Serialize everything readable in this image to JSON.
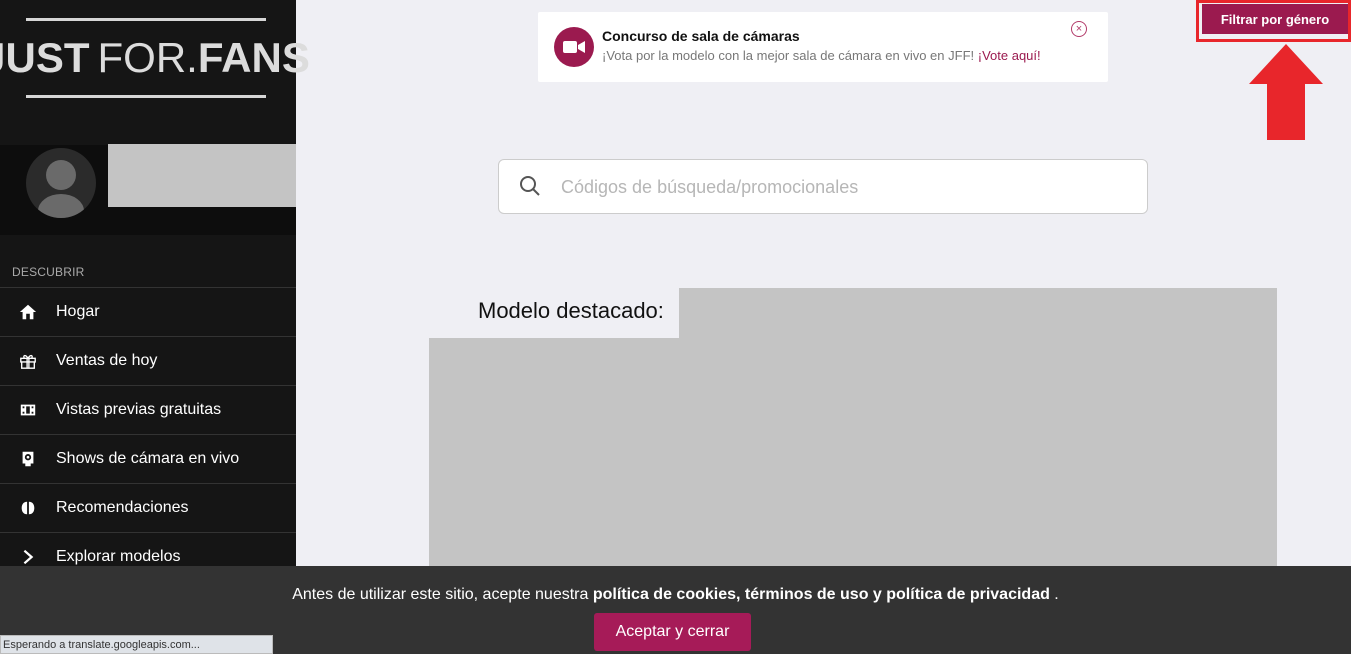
{
  "logo": {
    "part1": "JUST",
    "part2": "FOR.",
    "part3": "FANS"
  },
  "sidebar": {
    "section_label": "DESCUBRIR",
    "items": [
      {
        "label": "Hogar",
        "icon": "home-icon"
      },
      {
        "label": "Ventas de hoy",
        "icon": "gift-icon"
      },
      {
        "label": "Vistas previas gratuitas",
        "icon": "film-icon"
      },
      {
        "label": "Shows de cámara en vivo",
        "icon": "webcam-icon"
      },
      {
        "label": "Recomendaciones",
        "icon": "brain-icon"
      },
      {
        "label": "Explorar modelos",
        "icon": "chevron-right-icon"
      }
    ]
  },
  "notice": {
    "title": "Concurso de sala de cámaras",
    "text": "¡Vota por la modelo con la mejor sala de cámara en vivo en JFF! ",
    "link": "¡Vote aquí!"
  },
  "filter": {
    "label": "Filtrar por género"
  },
  "search": {
    "placeholder": "Códigos de búsqueda/promocionales"
  },
  "featured": {
    "label": "Modelo destacado:"
  },
  "cookie": {
    "prefix": "Antes de utilizar este sitio, acepte nuestra ",
    "bold": "política de cookies, términos de uso y política de privacidad",
    "suffix": " .",
    "button": "Aceptar y cerrar"
  },
  "status": {
    "text": "Esperando a translate.googleapis.com..."
  },
  "colors": {
    "accent": "#9b1a4f",
    "annotation": "#e8262b",
    "sidebar": "#151515"
  }
}
